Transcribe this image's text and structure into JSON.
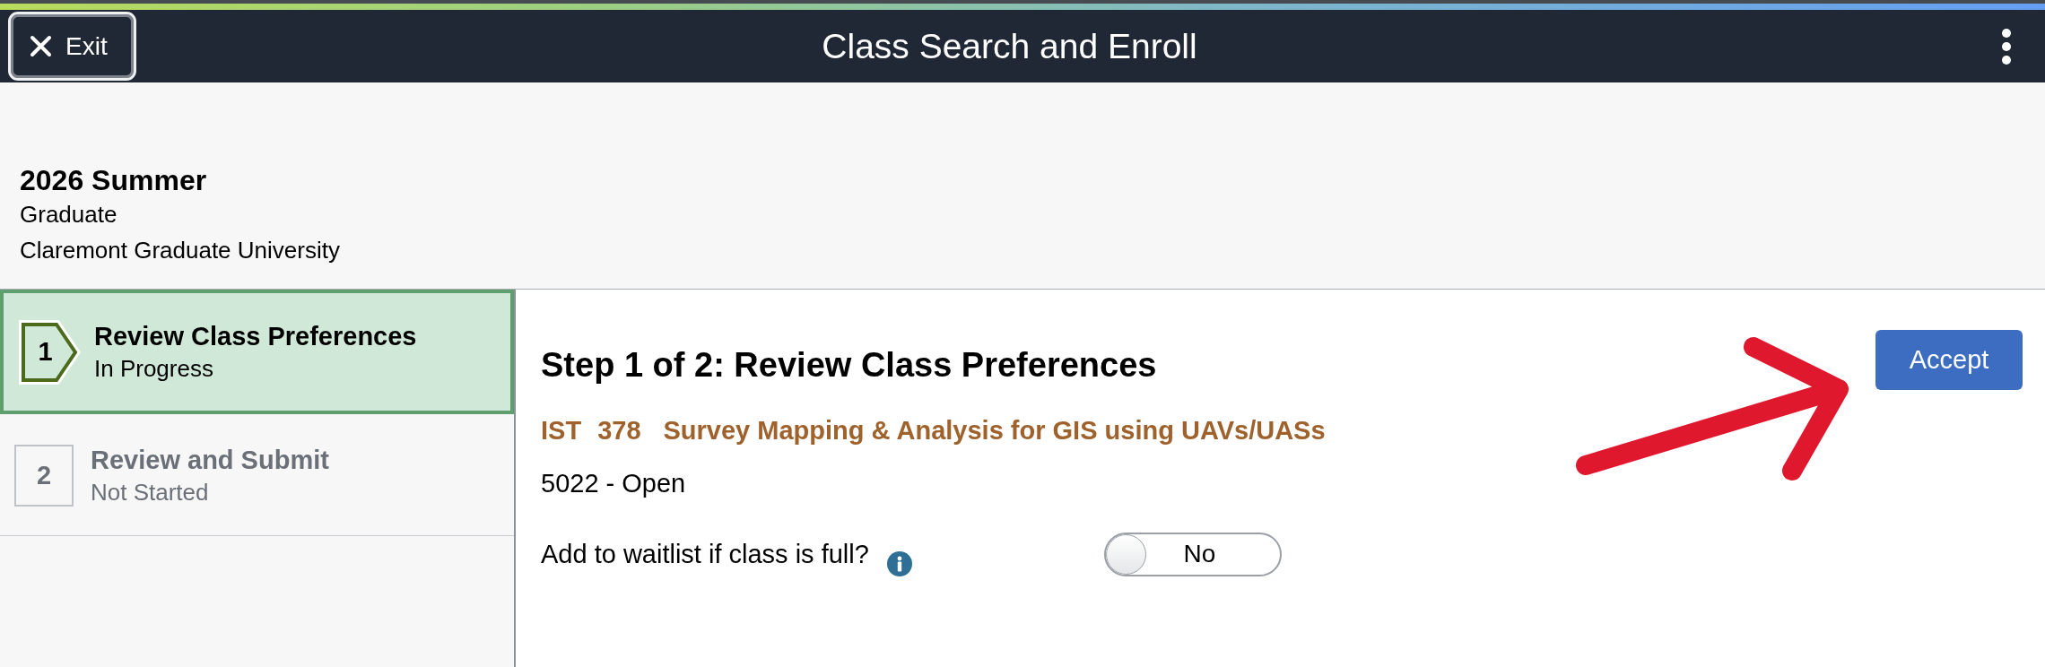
{
  "top_bar": {
    "exit_button": "Exit",
    "title": "Class Search and Enroll"
  },
  "term": {
    "name": "2026 Summer",
    "career": "Graduate",
    "institution": "Claremont Graduate University"
  },
  "steps": [
    {
      "number": "1",
      "title": "Review Class Preferences",
      "status": "In Progress",
      "selected": true
    },
    {
      "number": "2",
      "title": "Review and Submit",
      "status": "Not Started",
      "selected": false
    }
  ],
  "main": {
    "heading": "Step 1 of 2: Review Class Preferences",
    "accept_button": "Accept",
    "course": {
      "subject": "IST",
      "catalog_number": "378",
      "title": "Survey Mapping & Analysis for GIS using UAVs/UASs"
    },
    "section": "5022 - Open",
    "waitlist": {
      "label": "Add to waitlist if class is full?",
      "on": false,
      "value": "No"
    }
  }
}
